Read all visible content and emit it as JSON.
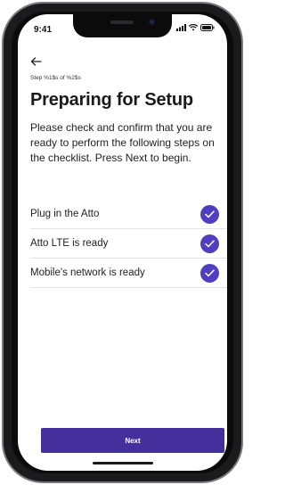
{
  "status_bar": {
    "time": "9:41"
  },
  "nav": {
    "back_icon": "arrow-left-icon"
  },
  "header": {
    "step_label": "Step %1$s of %2$s",
    "title": "Preparing for Setup"
  },
  "body": {
    "description": "Please check and confirm that you are ready to perform the following steps on the checklist. Press Next to begin."
  },
  "checklist": {
    "items": [
      {
        "label": "Plug in the Atto",
        "checked": true
      },
      {
        "label": "Atto LTE is ready",
        "checked": true
      },
      {
        "label": "Mobile's network is ready",
        "checked": true
      }
    ]
  },
  "footer": {
    "next_label": "Next"
  },
  "colors": {
    "accent": "#4f3ec2",
    "button": "#43309c"
  }
}
